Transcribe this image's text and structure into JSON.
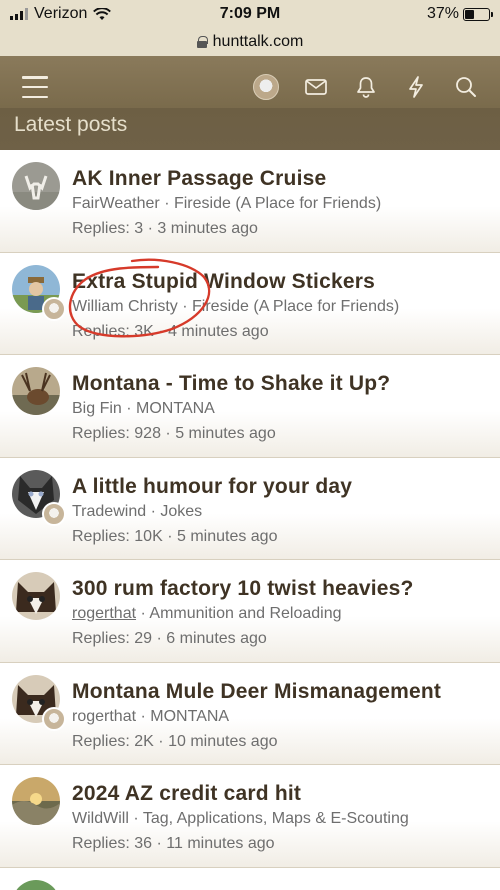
{
  "status_bar": {
    "carrier": "Verizon",
    "time": "7:09 PM",
    "battery": "37%",
    "battery_level": 0.37
  },
  "browser": {
    "url": "hunttalk.com"
  },
  "header": {
    "icons": [
      "menu-icon",
      "user-avatar",
      "mail-icon",
      "bell-icon",
      "lightning-icon",
      "search-icon"
    ],
    "section_title": "Latest posts"
  },
  "posts": [
    {
      "title": "AK Inner Passage Cruise",
      "author": "FairWeather",
      "forum": "Fireside (A Place for Friends)",
      "replies_label": "Replies:",
      "replies": "3",
      "time": "3 minutes ago"
    },
    {
      "title": "Extra Stupid Window Stickers",
      "author": "William Christy",
      "forum": "Fireside (A Place for Friends)",
      "replies_label": "Replies:",
      "replies": "3K",
      "time": "4 minutes ago"
    },
    {
      "title": "Montana - Time to Shake it Up?",
      "author": "Big Fin",
      "forum": "MONTANA",
      "replies_label": "Replies:",
      "replies": "928",
      "time": "5 minutes ago"
    },
    {
      "title": "A little humour for your day",
      "author": "Tradewind",
      "forum": "Jokes",
      "replies_label": "Replies:",
      "replies": "10K",
      "time": "5 minutes ago"
    },
    {
      "title": "300 rum factory 10 twist heavies?",
      "author": "rogerthat",
      "forum": "Ammunition and Reloading",
      "replies_label": "Replies:",
      "replies": "29",
      "time": "6 minutes ago"
    },
    {
      "title": "Montana Mule Deer Mismanagement",
      "author": "rogerthat",
      "forum": "MONTANA",
      "replies_label": "Replies:",
      "replies": "2K",
      "time": "10 minutes ago"
    },
    {
      "title": "2024 AZ credit card hit",
      "author": "WildWill",
      "forum": "Tag, Applications, Maps & E-Scouting",
      "replies_label": "Replies:",
      "replies": "36",
      "time": "11 minutes ago"
    }
  ],
  "separator": "·",
  "colors": {
    "header": "#7d6e50",
    "title_text": "#3f3324",
    "annotation": "#d63a2a"
  }
}
